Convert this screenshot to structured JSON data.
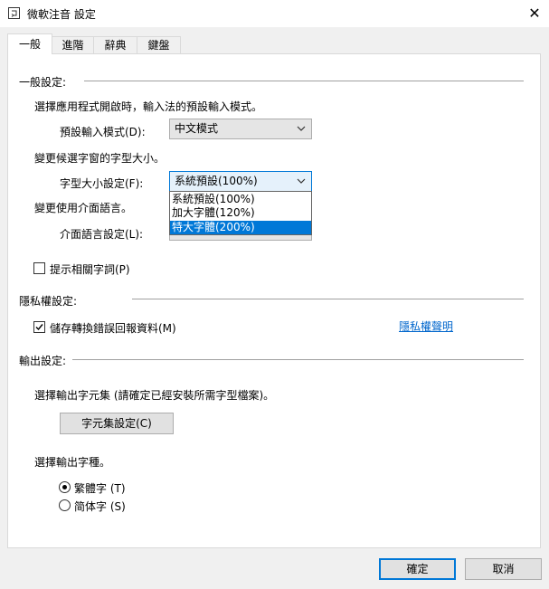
{
  "window": {
    "title": "微軟注音 設定",
    "close_glyph": "✕"
  },
  "tabs": [
    {
      "label": "一般"
    },
    {
      "label": "進階"
    },
    {
      "label": "辭典"
    },
    {
      "label": "鍵盤"
    }
  ],
  "general": {
    "section_title": "一般設定:",
    "default_mode_desc": "選擇應用程式開啟時，輸入法的預設輸入模式。",
    "default_mode_label": "預設輸入模式(D):",
    "default_mode_value": "中文模式",
    "font_size_desc": "變更候選字窗的字型大小。",
    "font_size_label": "字型大小設定(F):",
    "font_size_value": "系統預設(100%)",
    "font_size_options": [
      "系統預設(100%)",
      "加大字體(120%)",
      "特大字體(200%)"
    ],
    "ui_lang_desc": "變更使用介面語言。",
    "ui_lang_label": "介面語言設定(L):",
    "suggest_label": "提示相關字詞(P)",
    "suggest_checked": false
  },
  "privacy": {
    "section_title": "隱私權設定:",
    "report_label": "儲存轉換錯誤回報資料(M)",
    "report_checked": true,
    "statement_link": "隱私權聲明"
  },
  "output": {
    "section_title": "輸出設定:",
    "charset_desc": "選擇輸出字元集 (請確定已經安裝所需字型檔案)。",
    "charset_button": "字元集設定(C)",
    "script_desc": "選擇輸出字種。",
    "traditional_label": "繁體字 (T)",
    "simplified_label": "简体字 (S)",
    "selected": "traditional"
  },
  "footer": {
    "ok_label": "確定",
    "cancel_label": "取消"
  },
  "colors": {
    "accent": "#0078d7",
    "link": "#0066cc"
  }
}
